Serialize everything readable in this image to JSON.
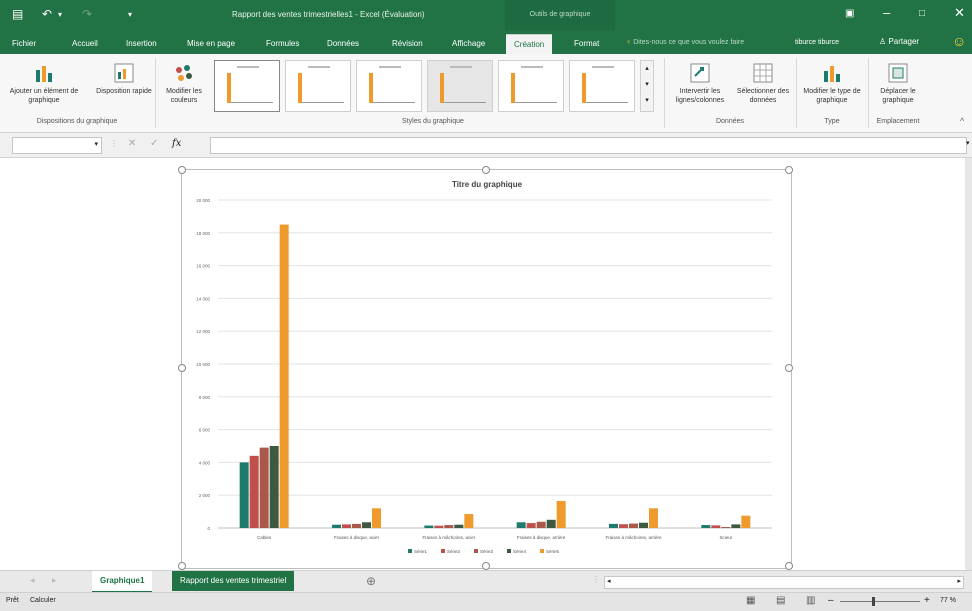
{
  "titlebar": {
    "window_title": "Rapport des ventes trimestrielles1 - Excel (Évaluation)",
    "context_title": "Outils de graphique"
  },
  "tabs": [
    "Fichier",
    "Accueil",
    "Insertion",
    "Mise en page",
    "Formules",
    "Données",
    "Révision",
    "Affichage",
    "Création",
    "Format"
  ],
  "active_tab": "Création",
  "tell_me": "Dites-nous ce que vous voulez faire",
  "user": "tiburce tiburce",
  "share": "Partager",
  "ribbon": {
    "add_element": "Ajouter un élément de graphique",
    "quick_layout": "Disposition rapide",
    "change_colors": "Modifier les couleurs",
    "group_layouts": "Dispositions du graphique",
    "group_styles": "Styles du graphique",
    "switch_rowcol": "Intervertir les lignes/colonnes",
    "select_data": "Sélectionner des données",
    "group_data": "Données",
    "change_type": "Modifier le type de graphique",
    "group_type": "Type",
    "move_chart": "Déplacer le graphique",
    "group_location": "Emplacement"
  },
  "formula_bar": {
    "fx": "fx",
    "value": ""
  },
  "chart_data": {
    "type": "bar",
    "title": "Titre du graphique",
    "categories": [
      "Cables",
      "Fraises à disque, acier",
      "Fraises à mâchoires, acier",
      "Fraises à disque, arrière",
      "Fraises à mâchoires, arrière",
      "Scieur"
    ],
    "series": [
      {
        "name": "Série1",
        "color": "#1f7a6e",
        "values": [
          4000,
          200,
          150,
          350,
          250,
          180
        ]
      },
      {
        "name": "Série2",
        "color": "#c0504d",
        "values": [
          4400,
          220,
          140,
          300,
          230,
          160
        ]
      },
      {
        "name": "Série3",
        "color": "#a9584a",
        "values": [
          4900,
          250,
          180,
          380,
          270,
          60
        ]
      },
      {
        "name": "Série4",
        "color": "#3d5942",
        "values": [
          5000,
          350,
          200,
          500,
          320,
          220
        ]
      },
      {
        "name": "Série5",
        "color": "#ee9a2c",
        "values": [
          18500,
          1200,
          850,
          1650,
          1200,
          750
        ]
      }
    ],
    "ylim": [
      0,
      20000
    ],
    "yticks": [
      "0",
      "2 000",
      "4 000",
      "6 000",
      "8 000",
      "10 000",
      "12 000",
      "14 000",
      "16 000",
      "18 000",
      "20 000"
    ],
    "grid": true,
    "legend_position": "bottom"
  },
  "sheet_tabs": {
    "tab1": "Graphique1",
    "tab2": "Rapport des ventes trimestriel",
    "add": "⊕"
  },
  "status": {
    "ready": "Prêt",
    "calc": "Calculer",
    "zoom": "77 %"
  }
}
